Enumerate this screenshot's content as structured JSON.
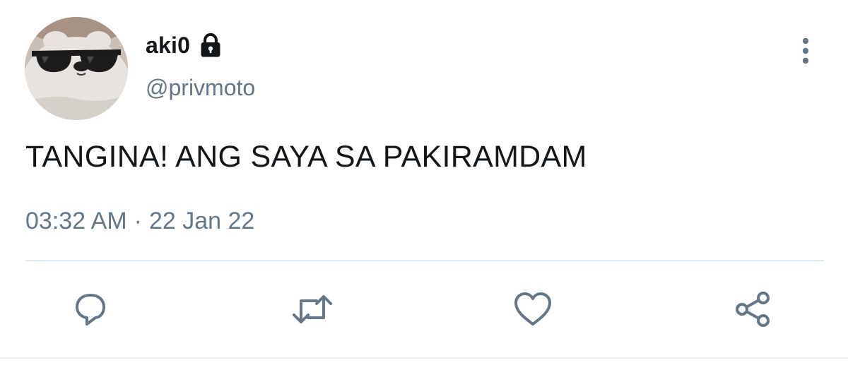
{
  "user": {
    "display_name": "aki0",
    "handle": "@privmoto",
    "avatar_icon": "bear-with-sunglasses-avatar",
    "protected_icon": "lock-icon"
  },
  "tweet": {
    "text": "TANGINA! ANG SAYA SA PAKIRAMDAM",
    "time": "03:32 AM",
    "separator": "·",
    "date": "22 Jan 22"
  },
  "actions": {
    "reply_icon": "reply-icon",
    "retweet_icon": "retweet-icon",
    "like_icon": "heart-icon",
    "share_icon": "share-icon",
    "more_icon": "more-vertical-icon"
  },
  "colors": {
    "text_primary": "#14171a",
    "text_secondary": "#657786",
    "divider": "#e1e8ed"
  }
}
